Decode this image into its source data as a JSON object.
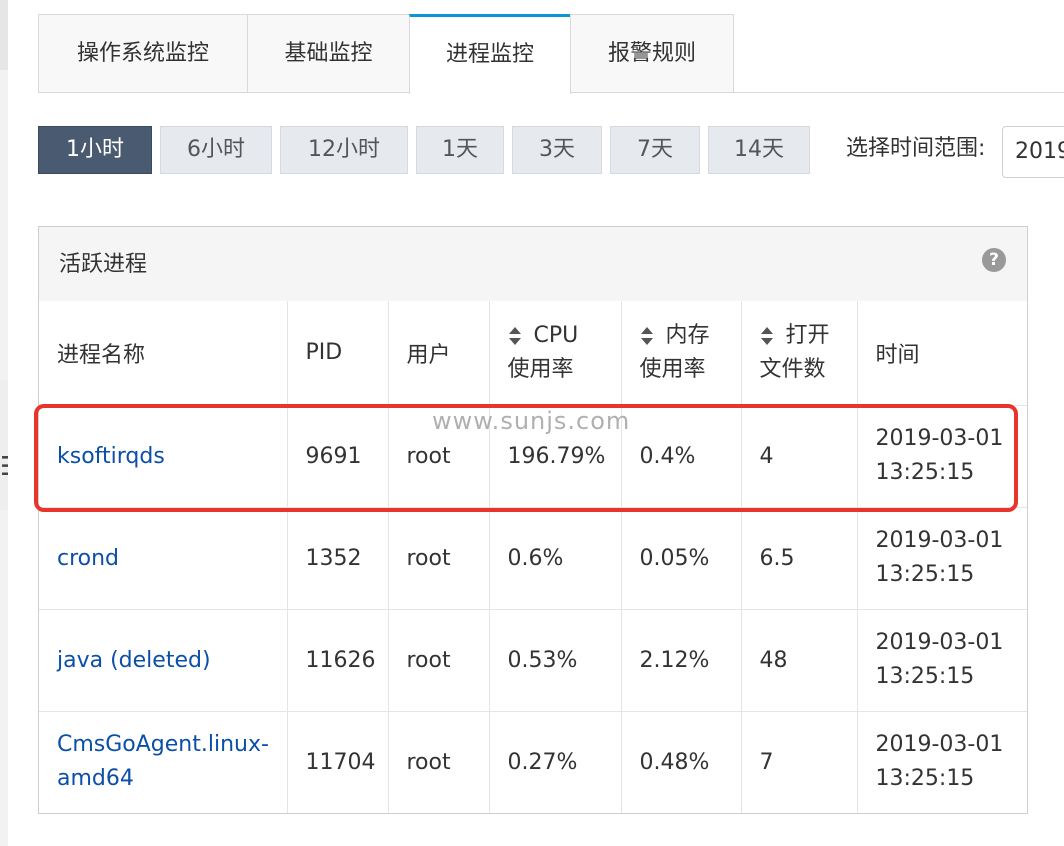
{
  "tabs": [
    "操作系统监控",
    "基础监控",
    "进程监控",
    "报警规则"
  ],
  "active_tab": "进程监控",
  "time_buttons": [
    "1小时",
    "6小时",
    "12小时",
    "1天",
    "3天",
    "7天",
    "14天"
  ],
  "active_time_button": "1小时",
  "range_label": "选择时间范围:",
  "range_value": "2019",
  "panel": {
    "title": "活跃进程",
    "help_icon": "?"
  },
  "table": {
    "headers": {
      "name": "进程名称",
      "pid": "PID",
      "user": "用户",
      "cpu_line1": "CPU",
      "cpu_line2": "使用率",
      "mem_line1": "内存",
      "mem_line2": "使用率",
      "files_line1": "打开",
      "files_line2": "文件数",
      "time": "时间"
    },
    "rows": [
      {
        "name": "ksoftirqds",
        "pid": "9691",
        "user": "root",
        "cpu": "196.79%",
        "mem": "0.4%",
        "files": "4",
        "date": "2019-03-01",
        "clock": "13:25:15"
      },
      {
        "name": "crond",
        "pid": "1352",
        "user": "root",
        "cpu": "0.6%",
        "mem": "0.05%",
        "files": "6.5",
        "date": "2019-03-01",
        "clock": "13:25:15"
      },
      {
        "name": "java (deleted)",
        "pid": "11626",
        "user": "root",
        "cpu": "0.53%",
        "mem": "2.12%",
        "files": "48",
        "date": "2019-03-01",
        "clock": "13:25:15"
      },
      {
        "name": "CmsGoAgent.linux-amd64",
        "pid": "11704",
        "user": "root",
        "cpu": "0.27%",
        "mem": "0.48%",
        "files": "7",
        "date": "2019-03-01",
        "clock": "13:25:15"
      }
    ]
  },
  "watermark": "www.sunjs.com",
  "colors": {
    "tab_active_accent": "#0a96d4",
    "time_button_active": "#4a5a70",
    "link": "#0b4fa8",
    "highlight": "#e8342a"
  }
}
